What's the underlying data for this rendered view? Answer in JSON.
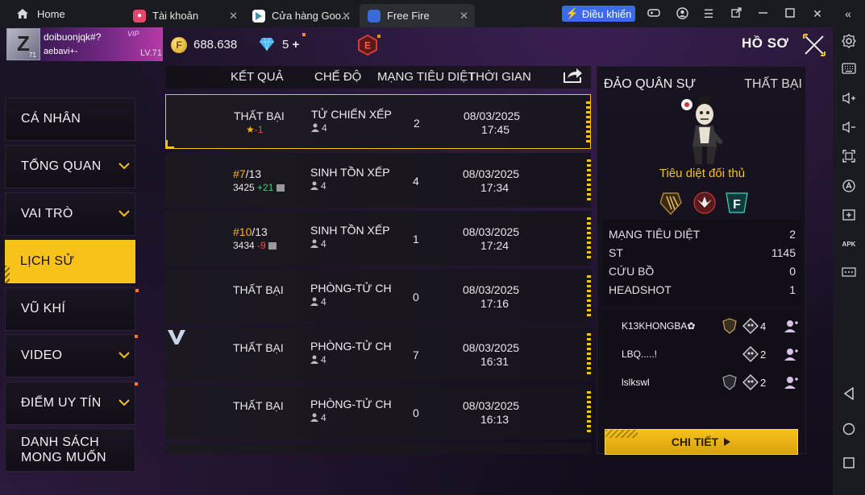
{
  "browser": {
    "home_label": "Home",
    "tabs": [
      {
        "label": "Tài khoản"
      },
      {
        "label": "Cửa hàng Goo..."
      },
      {
        "label": "Free Fire"
      }
    ],
    "control_label": "Điều khiển"
  },
  "header": {
    "avatar_letter": "Z",
    "avatar_level": "71",
    "name_line1": "doibuonjqk#?",
    "name_line2": "aebavi+-",
    "vip": "VIP",
    "level": "LV.71",
    "gold": "688.638",
    "diamonds": "5",
    "rank_badge": "E",
    "page_title": "HỒ SƠ"
  },
  "menu": [
    {
      "label": "CÁ NHÂN",
      "expandable": false
    },
    {
      "label": "TỔNG QUAN",
      "expandable": true
    },
    {
      "label": "VAI TRÒ",
      "expandable": true
    },
    {
      "label": "LỊCH SỬ",
      "expandable": false,
      "active": true
    },
    {
      "label": "VŨ KHÍ",
      "expandable": false
    },
    {
      "label": "VIDEO",
      "expandable": true
    },
    {
      "label": "ĐIỂM UY TÍN",
      "expandable": true
    },
    {
      "label_line1": "DANH SÁCH",
      "label_line2": "MONG MUỐN",
      "expandable": false
    }
  ],
  "table": {
    "headers": {
      "result": "KẾT QUẢ",
      "mode": "CHẾ ĐỘ",
      "kills": "MẠNG TIÊU DIỆT",
      "time": "THỜI GIAN"
    },
    "rows": [
      {
        "result": "THẤT BẠI",
        "sub_star": "★",
        "sub_delta": "-1",
        "mode": "TỬ CHIẾN XẾP HẠ",
        "players": "4",
        "kills": "2",
        "date": "08/03/2025",
        "time": "17:45"
      },
      {
        "rank": "#7",
        "total": "/13",
        "score": "3425",
        "delta": "+21",
        "mode": "SINH TỒN XẾP HẠ",
        "players": "4",
        "kills": "4",
        "date": "08/03/2025",
        "time": "17:34"
      },
      {
        "rank": "#10",
        "total": "/13",
        "score": "3434",
        "delta": "-9",
        "mode": "SINH TỒN XẾP HẠ",
        "players": "4",
        "kills": "1",
        "date": "08/03/2025",
        "time": "17:24"
      },
      {
        "result": "THẤT BẠI",
        "mode": "PHÒNG-TỬ CHIẾN",
        "players": "4",
        "kills": "0",
        "date": "08/03/2025",
        "time": "17:16"
      },
      {
        "result": "THẤT BẠI",
        "mode": "PHÒNG-TỬ CHIẾN",
        "players": "4",
        "kills": "7",
        "date": "08/03/2025",
        "time": "16:31"
      },
      {
        "result": "THẤT BẠI",
        "mode": "PHÒNG-TỬ CHIẾN",
        "players": "4",
        "kills": "0",
        "date": "08/03/2025",
        "time": "16:13"
      }
    ]
  },
  "detail": {
    "map": "ĐẢO QUÂN SỰ",
    "result": "THẤT BẠI",
    "caption": "Tiêu diệt đối thủ",
    "stats": [
      {
        "label": "MẠNG TIÊU DIỆT",
        "value": "2"
      },
      {
        "label": "ST",
        "value": "1145"
      },
      {
        "label": "CỨU BỒ",
        "value": "0"
      },
      {
        "label": "HEADSHOT",
        "value": "1"
      }
    ],
    "team": [
      {
        "name": "K13KHONGBA✿",
        "kills": "4"
      },
      {
        "name": "LBQ.....!",
        "kills": "2"
      },
      {
        "name": "lslkswl",
        "kills": "2"
      }
    ],
    "button_label": "CHI TIẾT"
  },
  "colors": {
    "accent": "#f7c21a",
    "gain": "#39d46c",
    "loss": "#ff4a4a",
    "rank": "#f7b21a"
  }
}
